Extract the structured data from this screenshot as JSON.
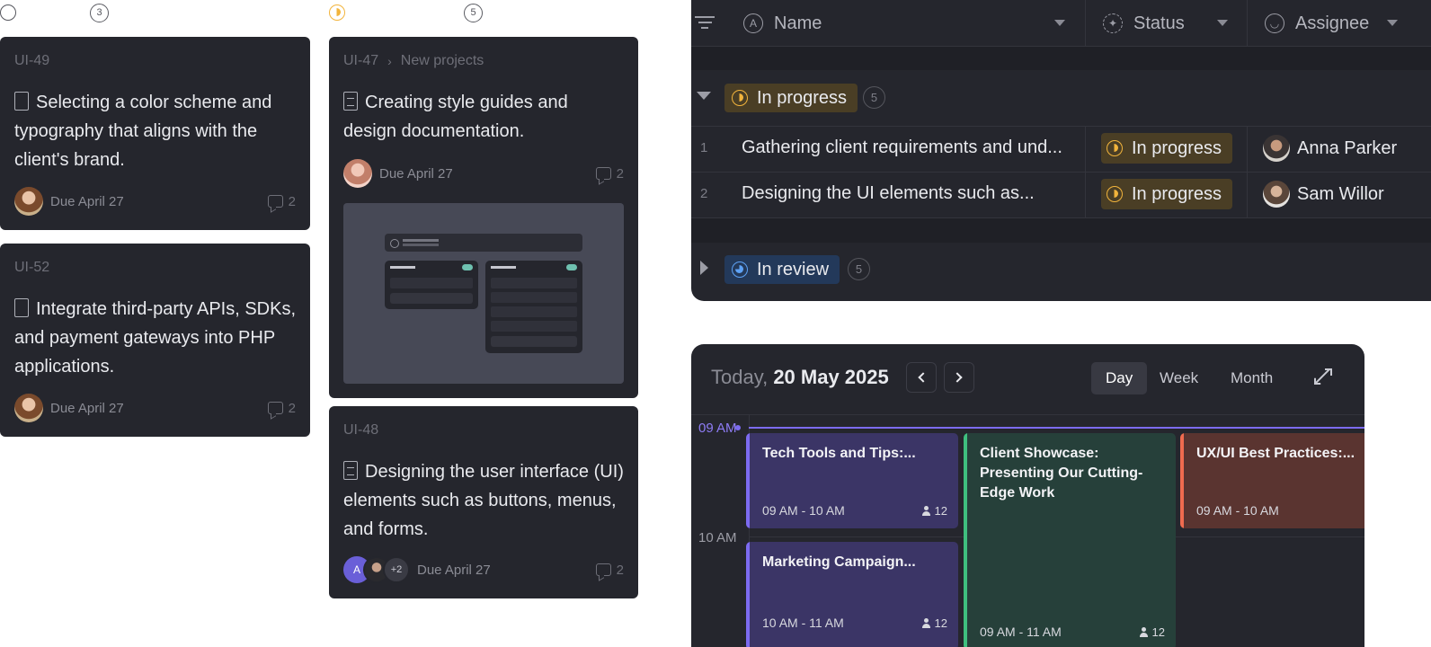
{
  "board": {
    "col1": {
      "count": "3"
    },
    "col2": {
      "count": "5"
    },
    "cards": [
      {
        "id": "UI-49",
        "title": "Selecting a color scheme and typography that aligns with the client's brand.",
        "due": "Due April 27",
        "comments": "2"
      },
      {
        "id": "UI-52",
        "title": "Integrate third-party APIs, SDKs, and payment gateways into PHP applications.",
        "due": "Due April 27",
        "comments": "2"
      },
      {
        "id": "UI-47",
        "crumb": "New projects",
        "title": "Creating style guides and design documentation.",
        "due": "Due April 27",
        "comments": "2"
      },
      {
        "id": "UI-48",
        "title": "Designing the user interface (UI) elements such as buttons, menus, and forms.",
        "due": "Due April 27",
        "comments": "2",
        "avatar_initial": "A",
        "avatar_more": "+2"
      }
    ]
  },
  "table": {
    "columns": {
      "name": "Name",
      "status": "Status",
      "assignee": "Assignee",
      "name_icon": "A"
    },
    "groups": [
      {
        "label": "In progress",
        "count": "5",
        "expanded": true
      },
      {
        "label": "In review",
        "count": "5",
        "expanded": false
      }
    ],
    "rows": [
      {
        "num": "1",
        "name": "Gathering client requirements and und...",
        "status": "In progress",
        "assignee": "Anna Parker"
      },
      {
        "num": "2",
        "name": "Designing the UI elements such as...",
        "status": "In progress",
        "assignee": "Sam Willor"
      }
    ]
  },
  "calendar": {
    "today_label": "Today,",
    "date": "20 May 2025",
    "views": [
      "Day",
      "Week",
      "Month"
    ],
    "active_view": "Day",
    "hours": [
      "09 AM",
      "10 AM"
    ],
    "events": [
      {
        "title": "Tech Tools and Tips:...",
        "time": "09 AM - 10 AM",
        "people": "12",
        "color": "#7c6bf0"
      },
      {
        "title": "Client Showcase:\nPresenting Our Cutting-\nEdge Work",
        "time": "09 AM - 11 AM",
        "people": "12",
        "color": "#3fbf7f"
      },
      {
        "title": "UX/UI Best Practices:...",
        "time": "09 AM - 10 AM",
        "people": "",
        "color": "#ef6b4f"
      },
      {
        "title": "Marketing Campaign...",
        "time": "10 AM - 11 AM",
        "people": "12",
        "color": "#7c6bf0"
      }
    ]
  },
  "colors": {
    "panel": "#25262d",
    "accent": "#7c6bf0",
    "in_progress": "#f2b43c",
    "in_review": "#5ea2f5"
  }
}
